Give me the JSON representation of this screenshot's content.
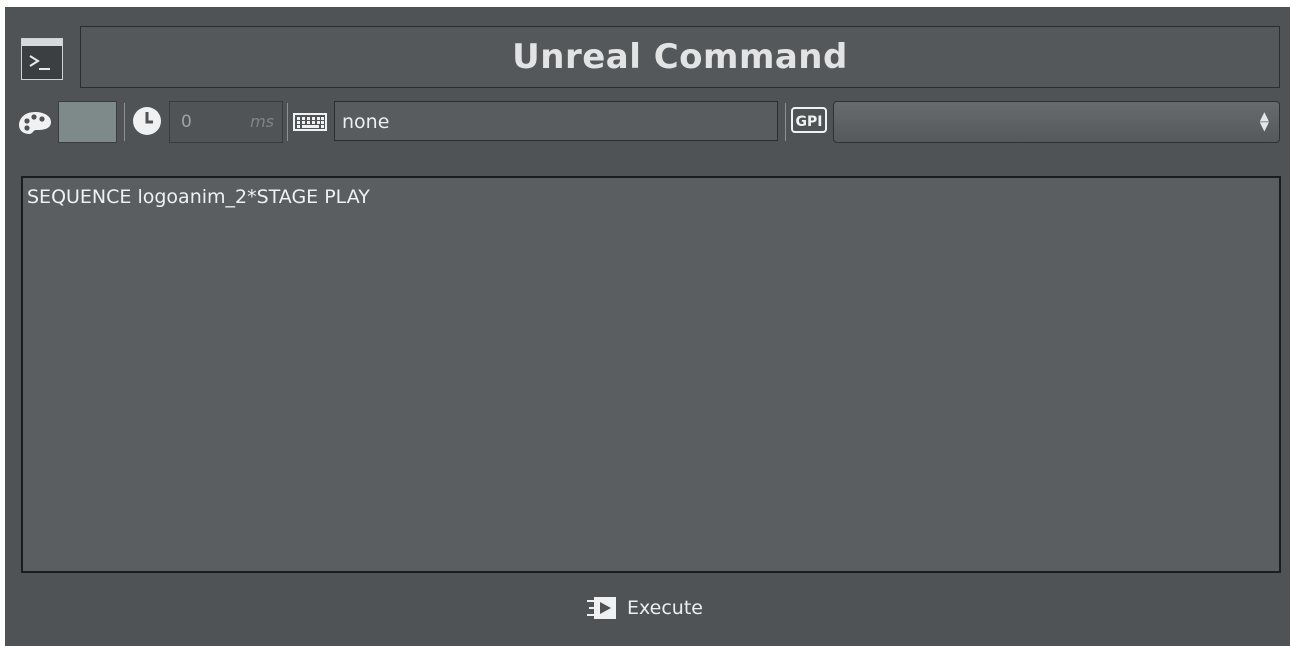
{
  "header": {
    "title": "Unreal Command",
    "command_icon": "terminal-icon"
  },
  "toolbar": {
    "color_icon": "palette-icon",
    "color_swatch": "#7e8a8a",
    "delay_icon": "clock-icon",
    "delay_value": "0",
    "delay_unit": "ms",
    "key_icon": "keyboard-icon",
    "key_value": "none",
    "gpi_icon": "gpi-icon",
    "gpi_label": "GPI",
    "gpi_value": ""
  },
  "editor": {
    "text": "SEQUENCE logoanim_2*STAGE PLAY"
  },
  "footer": {
    "execute_icon": "execute-icon",
    "execute_label": "Execute"
  },
  "colors": {
    "panel_bg": "#4f5355",
    "editor_bg": "#5a5e60",
    "text": "#eceeef"
  }
}
